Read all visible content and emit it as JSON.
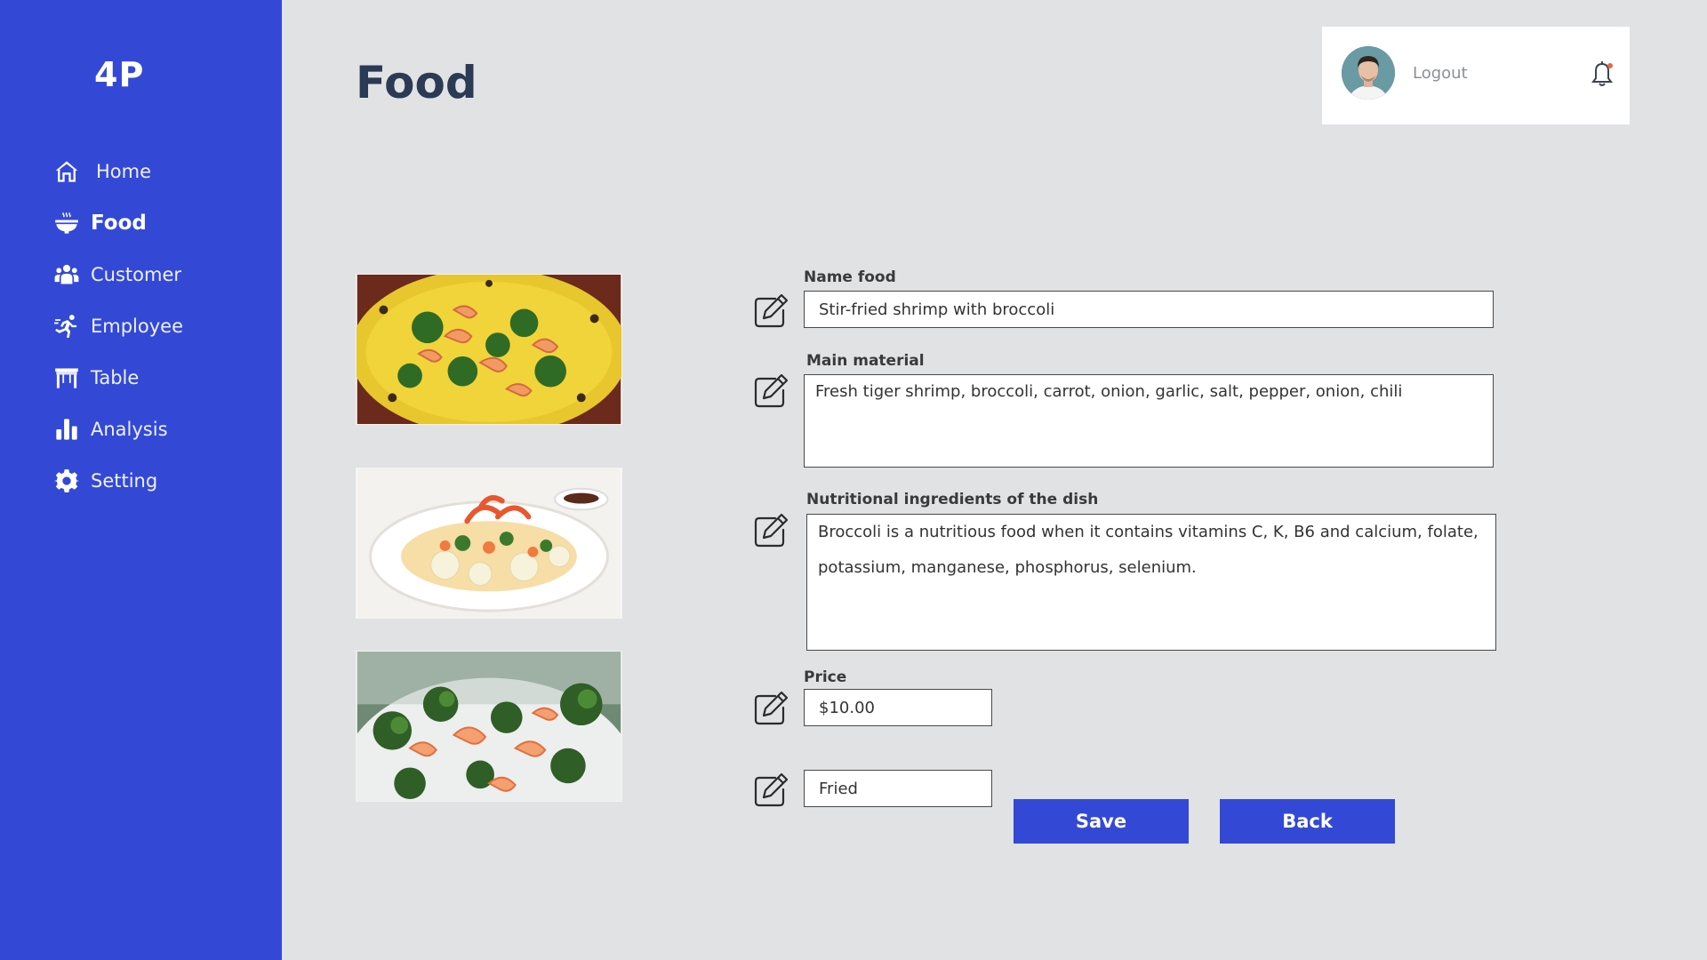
{
  "app": {
    "logo": "4P"
  },
  "sidebar": {
    "items": [
      {
        "label": "Home",
        "icon": "home-icon"
      },
      {
        "label": "Food",
        "icon": "bowl-icon",
        "active": true
      },
      {
        "label": "Customer",
        "icon": "users-icon"
      },
      {
        "label": "Employee",
        "icon": "running-person-icon"
      },
      {
        "label": "Table",
        "icon": "table-icon"
      },
      {
        "label": "Analysis",
        "icon": "bar-chart-icon"
      },
      {
        "label": "Setting",
        "icon": "gear-icon"
      }
    ]
  },
  "header": {
    "title": "Food"
  },
  "user": {
    "logout_label": "Logout",
    "bell_icon": "bell-icon",
    "has_notification": true
  },
  "images": [
    {
      "icon": "shrimp-broccoli-plate-photo"
    },
    {
      "icon": "shrimp-vegetables-white-plate-photo"
    },
    {
      "icon": "shrimp-broccoli-bowl-photo"
    }
  ],
  "form": {
    "name_label": "Name food",
    "name_value": "Stir-fried shrimp with broccoli",
    "material_label": "Main material",
    "material_value": "Fresh tiger shrimp, broccoli, carrot, onion, garlic, salt, pepper, onion, chili",
    "nutrition_label": "Nutritional ingredients of the dish",
    "nutrition_value": "Broccoli is a nutritious food when it contains vitamins C, K, B6 and calcium, folate, potassium, manganese, phosphorus, selenium.",
    "price_label": "Price",
    "price_value": "$10.00",
    "type_value": "Fried"
  },
  "buttons": {
    "save_label": "Save",
    "back_label": "Back"
  },
  "colors": {
    "accent": "#3349d6",
    "background": "#e1e2e4",
    "notification_dot": "#e8654a"
  }
}
